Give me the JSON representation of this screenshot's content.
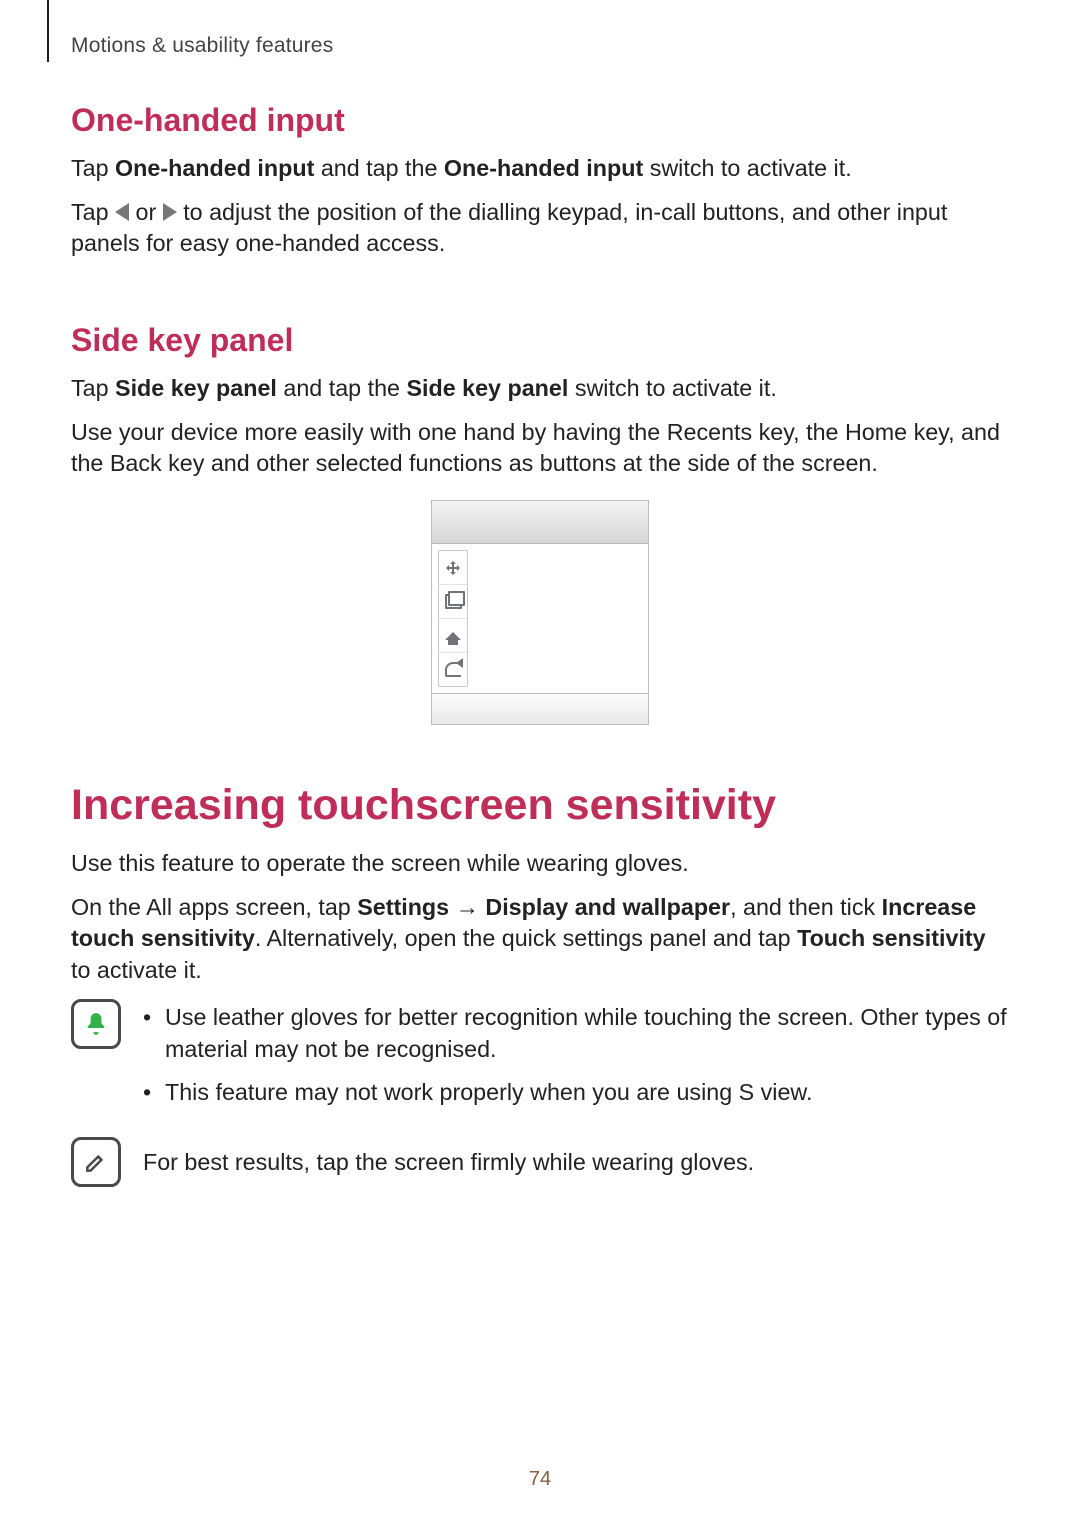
{
  "breadcrumb": "Motions & usability features",
  "sections": {
    "one_handed": {
      "heading": "One-handed input",
      "p1_a": "Tap ",
      "p1_b": "One-handed input",
      "p1_c": " and tap the ",
      "p1_d": "One-handed input",
      "p1_e": " switch to activate it.",
      "p2_a": "Tap ",
      "p2_b": " or ",
      "p2_c": " to adjust the position of the dialling keypad, in-call buttons, and other input panels for easy one-handed access."
    },
    "side_key": {
      "heading": "Side key panel",
      "p1_a": "Tap ",
      "p1_b": "Side key panel",
      "p1_c": " and tap the ",
      "p1_d": "Side key panel",
      "p1_e": " switch to activate it.",
      "p2": "Use your device more easily with one hand by having the Recents key, the Home key, and the Back key and other selected functions as buttons at the side of the screen."
    },
    "touch_sensitivity": {
      "heading": "Increasing touchscreen sensitivity",
      "p1": "Use this feature to operate the screen while wearing gloves.",
      "p2_a": "On the All apps screen, tap ",
      "p2_b": "Settings",
      "p2_arrow": " → ",
      "p2_c": "Display and wallpaper",
      "p2_d": ", and then tick ",
      "p2_e": "Increase touch sensitivity",
      "p2_f": ". Alternatively, open the quick settings panel and tap ",
      "p2_g": "Touch sensitivity",
      "p2_h": " to activate it.",
      "notes_green": [
        "Use leather gloves for better recognition while touching the screen. Other types of material may not be recognised.",
        "This feature may not work properly when you are using S view."
      ],
      "note_grey": "For best results, tap the screen firmly while wearing gloves."
    }
  },
  "figure": {
    "side_keys": [
      "move-icon",
      "recents-icon",
      "home-icon",
      "back-icon"
    ]
  },
  "page_number": "74"
}
